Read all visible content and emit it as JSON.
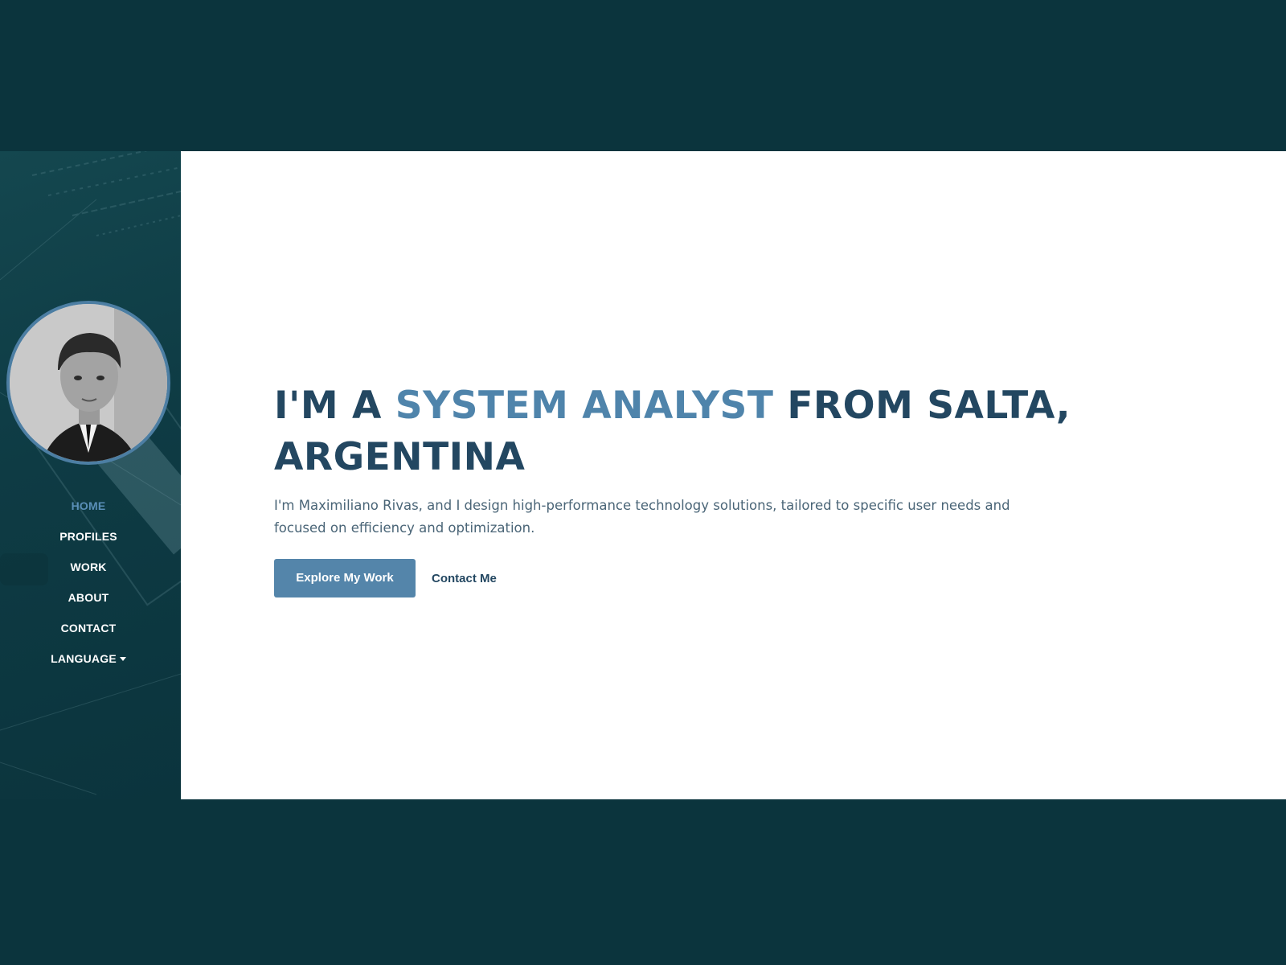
{
  "sidebar": {
    "nav": [
      {
        "label": "HOME",
        "active": true
      },
      {
        "label": "PROFILES"
      },
      {
        "label": "WORK"
      },
      {
        "label": "ABOUT"
      },
      {
        "label": "CONTACT"
      },
      {
        "label": "LANGUAGE",
        "icon": "caret-down-icon"
      }
    ]
  },
  "hero": {
    "heading_prefix": "I'M A ",
    "heading_accent": "SYSTEM ANALYST",
    "heading_suffix": " FROM SALTA, ARGENTINA",
    "description": "I'm Maximiliano Rivas, and I design high-performance technology solutions, tailored to specific user needs and focused on efficiency and optimization.",
    "primary_button": "Explore My Work",
    "secondary_button": "Contact Me"
  },
  "colors": {
    "background": "#0b343d",
    "accent": "#4f84ab",
    "heading": "#234761",
    "button": "#5485aa"
  }
}
